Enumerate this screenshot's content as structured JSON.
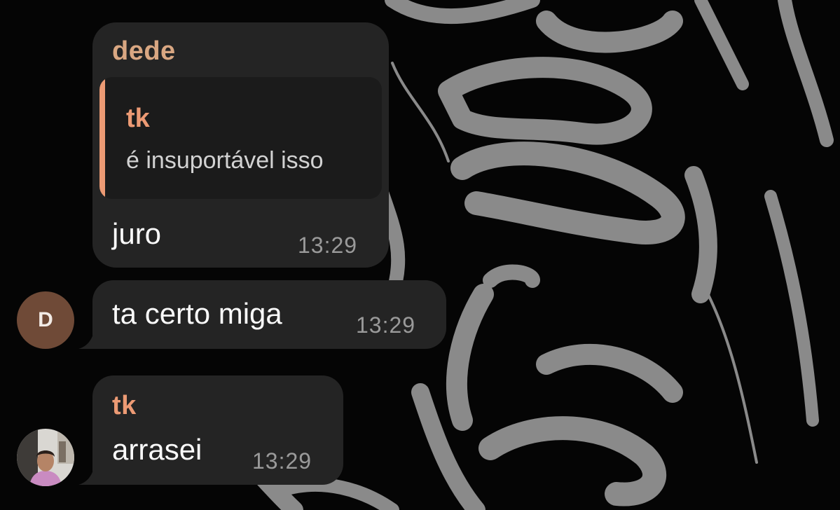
{
  "colors": {
    "background": "#050505",
    "bubble": "#242424",
    "quote_bg": "#1b1b1b",
    "dede_name": "#d9a782",
    "tk_name": "#ec9a74",
    "timestamp": "#9a9a9a",
    "avatar_d": "#6f4a37"
  },
  "messages": [
    {
      "sender": "dede",
      "reply_to": {
        "sender": "tk",
        "text": "é insuportável isso"
      },
      "text": "juro",
      "time": "13:29"
    },
    {
      "text": "ta certo miga",
      "time": "13:29",
      "avatar": {
        "initial": "D"
      }
    },
    {
      "sender": "tk",
      "text": "arrasei",
      "time": "13:29",
      "avatar": {
        "type": "photo"
      }
    }
  ]
}
